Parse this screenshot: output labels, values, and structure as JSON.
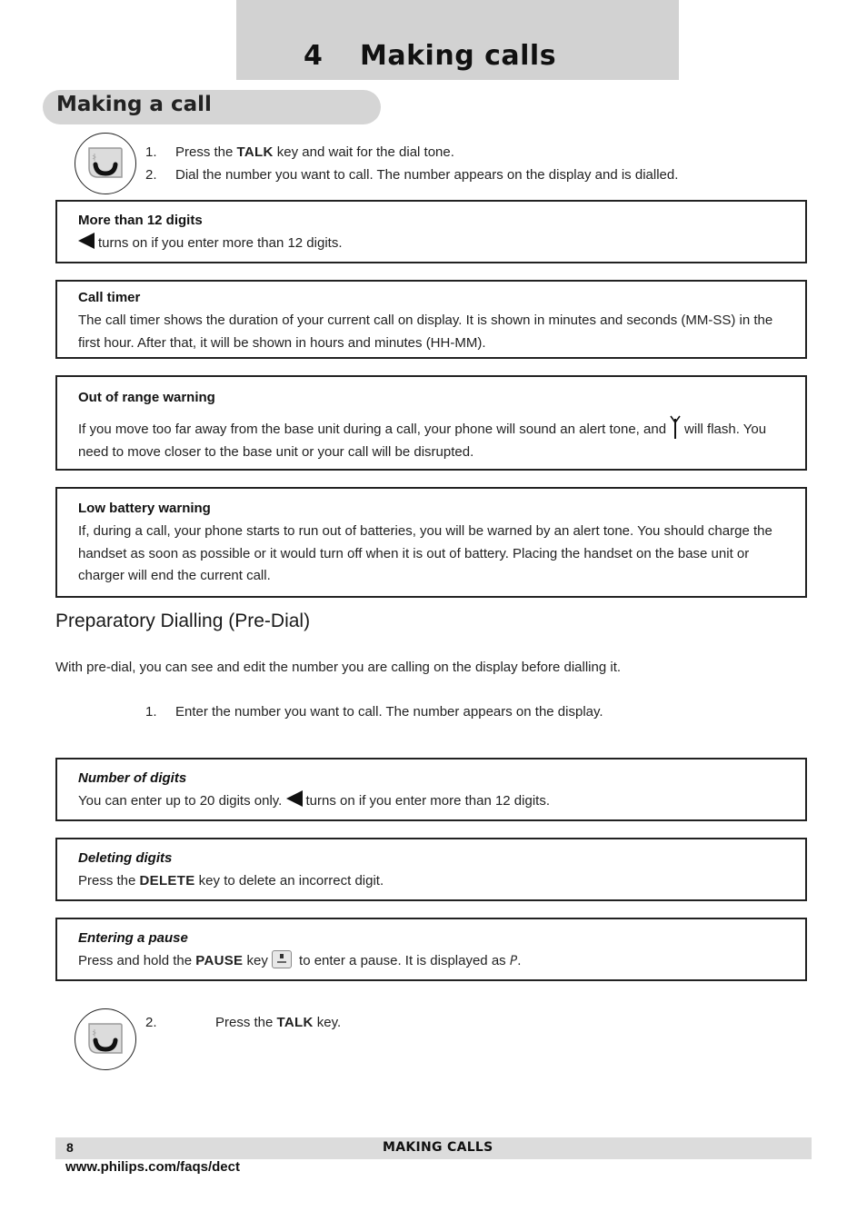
{
  "chapter": {
    "number": "4",
    "title": "Making calls"
  },
  "section": {
    "title": "Making a call",
    "key_icon": "talk-key-icon",
    "steps": [
      {
        "num": "1.",
        "pre": "Press the ",
        "key": "TALK",
        "post": " key and wait for the dial tone."
      },
      {
        "num": "2.",
        "text": "Dial the number you want to call.  The number appears on the display and is dialled."
      }
    ]
  },
  "notes": [
    {
      "heading": "More than 12 digits",
      "icon": "left-arrow-indicator-icon",
      "text": "turns on if you enter more than 12 digits."
    },
    {
      "heading": "Call timer",
      "text": "The call timer shows the duration of your current call on display.  It is shown in minutes and seconds (MM-SS) in the first hour.  After that, it will be shown in hours and minutes (HH-MM)."
    },
    {
      "heading": "Out of range warning",
      "text_before": "If you move too far away from the base unit during a call, your phone will sound an alert tone, and",
      "icon": "antenna-signal-icon",
      "text_after": "will flash. You need to move closer to the base unit or your call will be disrupted."
    },
    {
      "heading": "Low battery warning",
      "text": "If, during a call, your phone starts to run out of batteries, you will be warned by an alert tone.  You should charge the handset as soon as possible or it would turn off when it is out of battery.  Placing the handset on the base unit or charger will end the current call."
    }
  ],
  "predial": {
    "heading": "Preparatory Dialling (Pre-Dial)",
    "intro": "With pre-dial, you can see and edit the number you are calling on the display before dialling it.",
    "step1": {
      "num": "1.",
      "text": "Enter the number you want to call.  The number appears on the display."
    },
    "notes": [
      {
        "heading": "Number of digits",
        "text_before": "You can enter up to 20 digits only.",
        "icon": "left-arrow-indicator-icon",
        "text_after": "turns on if you enter more than 12 digits."
      },
      {
        "heading": "Deleting digits",
        "pre": "Press the ",
        "key": "DELETE",
        "post": " key to delete an incorrect digit."
      },
      {
        "heading": "Entering a pause",
        "pre": "Press and hold the ",
        "key": "PAUSE",
        "mid": " key",
        "icon": "pause-key-icon",
        "post": " to enter a pause.  It is displayed as ",
        "glyph": "P",
        "end": "."
      }
    ],
    "step2": {
      "num": "2.",
      "pre": "Press the ",
      "key": "TALK",
      "post": " key."
    }
  },
  "footer": {
    "page_number": "8",
    "section_title": "MAKING CALLS",
    "url": "www.philips.com/faqs/dect"
  }
}
